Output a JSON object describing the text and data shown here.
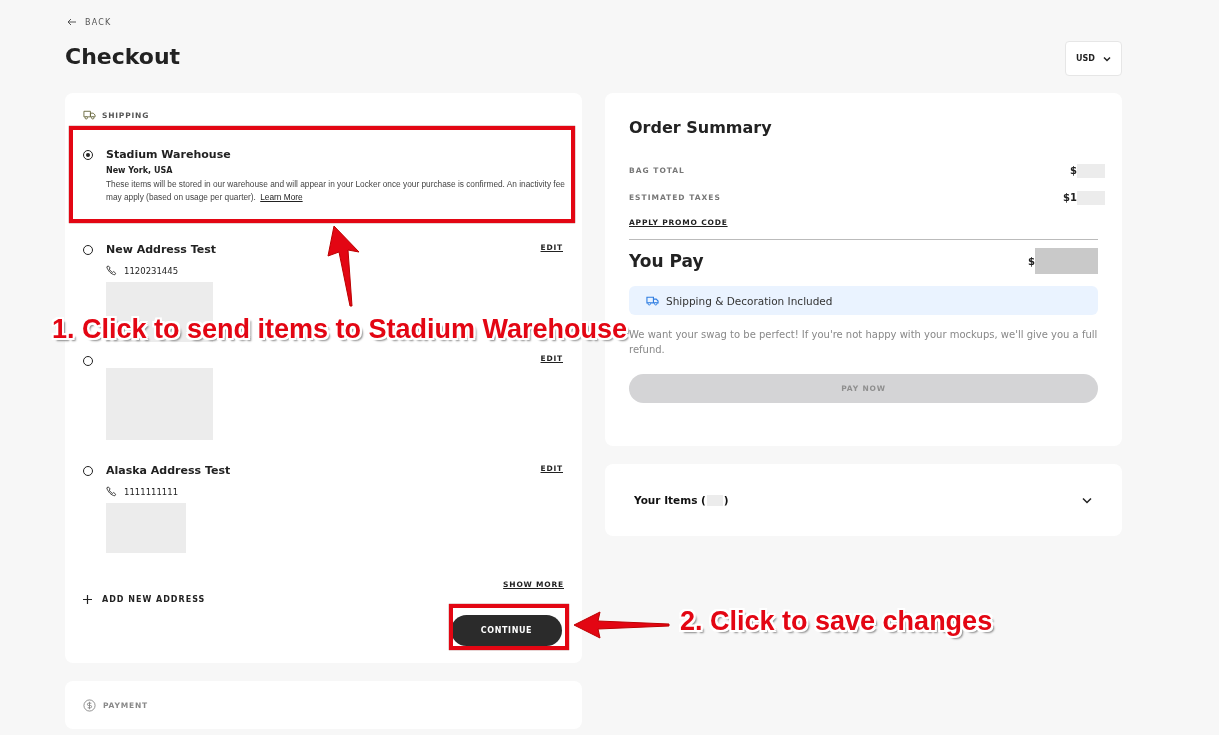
{
  "back": "BACK",
  "title": "Checkout",
  "currency": "USD",
  "shipping": {
    "label": "SHIPPING",
    "options": [
      {
        "kind": "warehouse",
        "selected": true,
        "name": "Stadium Warehouse",
        "location": "New York, USA",
        "description": "These items will be stored in our warehouse and will appear in your Locker once your purchase is confirmed. An inactivity fee may apply (based on usage per quarter).",
        "link": "Learn More"
      },
      {
        "kind": "address",
        "selected": false,
        "name": "New Address Test",
        "phone": "1120231445",
        "edit": "EDIT"
      },
      {
        "kind": "address",
        "selected": false,
        "edit": "EDIT"
      },
      {
        "kind": "address",
        "selected": false,
        "name": "Alaska Address Test",
        "phone": "1111111111",
        "edit": "EDIT"
      }
    ],
    "show_more": "SHOW MORE",
    "add_address": "ADD NEW ADDRESS",
    "continue": "CONTINUE"
  },
  "payment": {
    "label": "PAYMENT"
  },
  "summary": {
    "title": "Order Summary",
    "lines": [
      {
        "label": "BAG TOTAL",
        "value": "$"
      },
      {
        "label": "ESTIMATED TAXES",
        "value": "$1"
      }
    ],
    "promo": "APPLY PROMO CODE",
    "you_pay": "You Pay",
    "total": "$",
    "included": "Shipping & Decoration Included",
    "guarantee": "We want your swag to be perfect! If you're not happy with your mockups, we'll give you a full refund.",
    "pay_now": {
      "label": "PAY NOW",
      "disabled": true
    }
  },
  "items": {
    "title_parts": [
      "Your Items (",
      ")"
    ]
  },
  "annotations": [
    {
      "kind": "option",
      "text": "1. Click to send items to Stadium Warehouse"
    },
    {
      "kind": "button",
      "text": "2. Click to save changes"
    }
  ]
}
